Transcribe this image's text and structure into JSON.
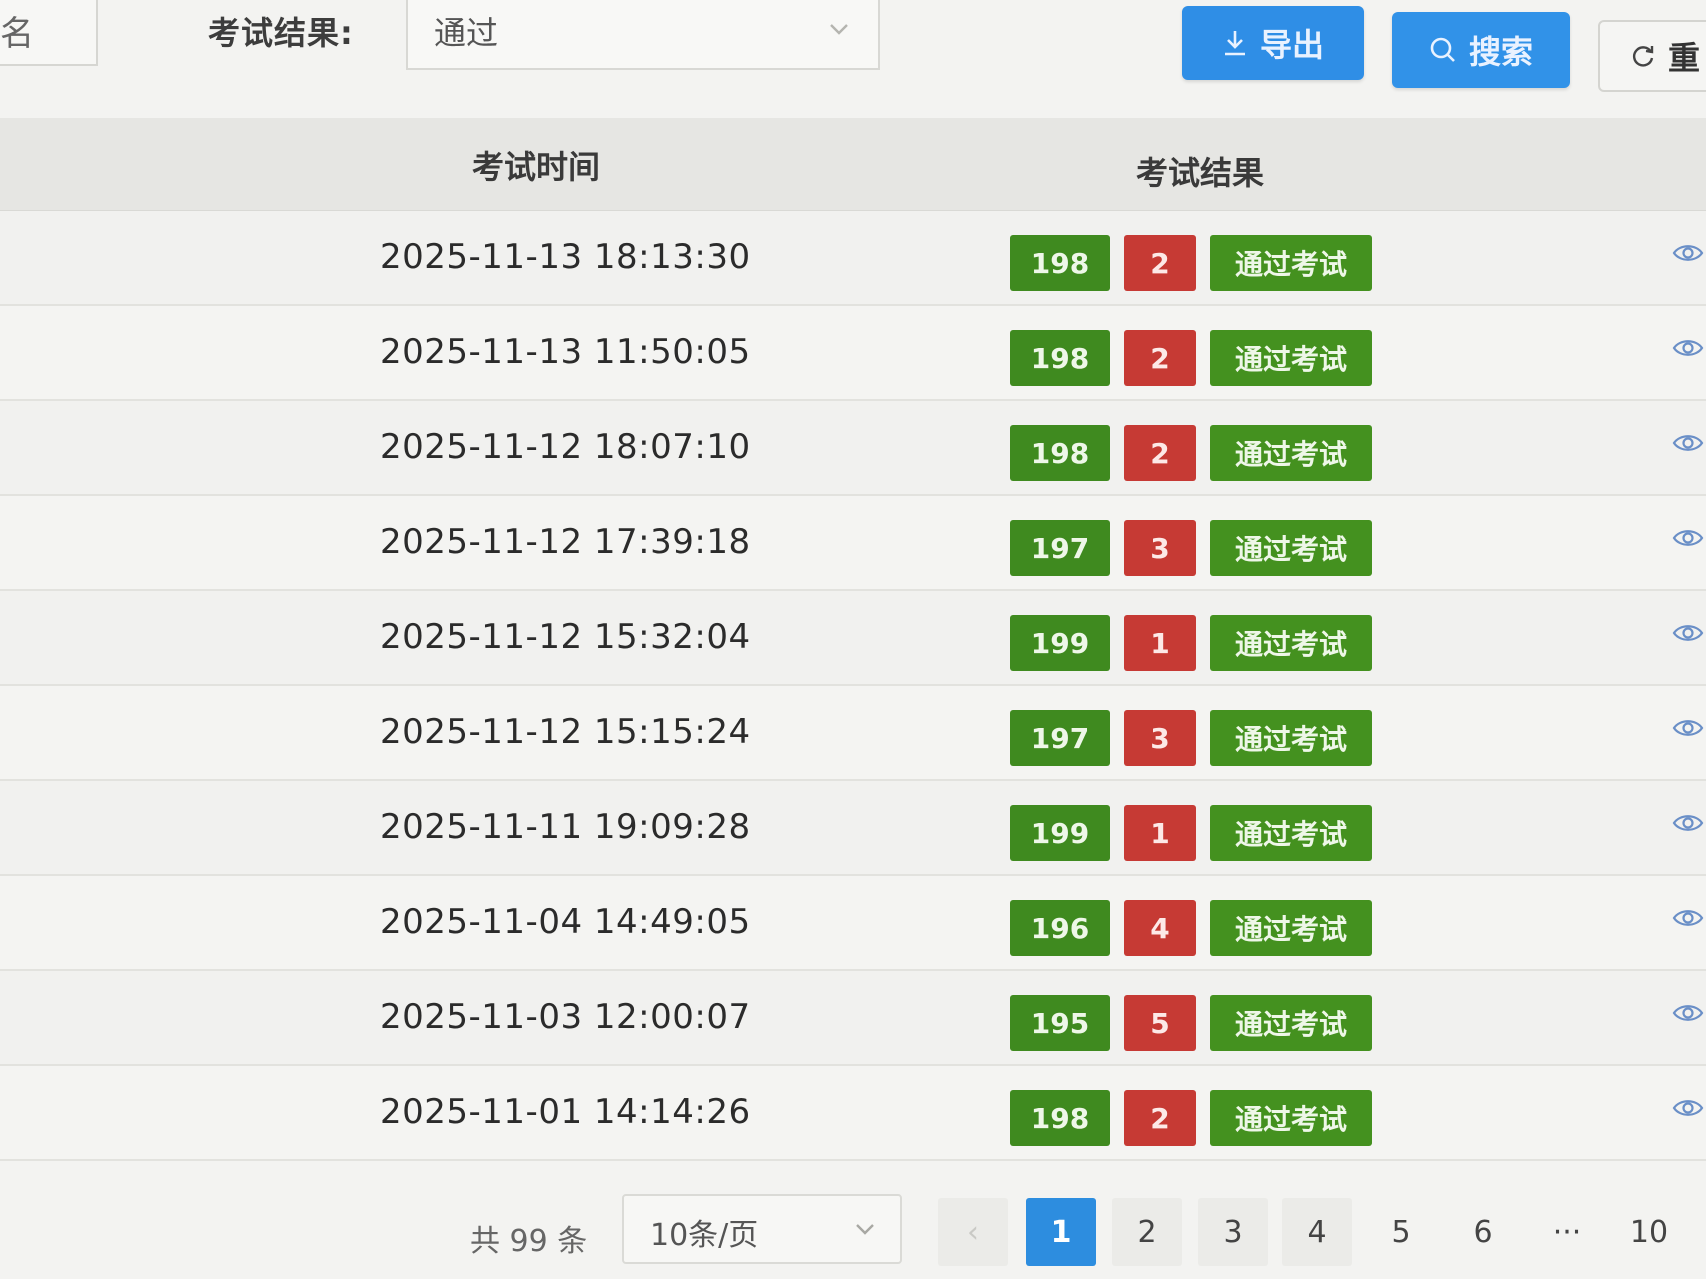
{
  "filter": {
    "name_label_partial": "名",
    "result_label": "考试结果:",
    "result_value": "通过"
  },
  "toolbar": {
    "export_label": "导出",
    "search_label": "搜索",
    "reset_label": "重"
  },
  "table": {
    "headers": {
      "time": "考试时间",
      "result": "考试结果"
    },
    "rows": [
      {
        "time": "2025-11-13 18:13:30",
        "score": "198",
        "wrong": "2",
        "status": "通过考试"
      },
      {
        "time": "2025-11-13 11:50:05",
        "score": "198",
        "wrong": "2",
        "status": "通过考试"
      },
      {
        "time": "2025-11-12 18:07:10",
        "score": "198",
        "wrong": "2",
        "status": "通过考试"
      },
      {
        "time": "2025-11-12 17:39:18",
        "score": "197",
        "wrong": "3",
        "status": "通过考试"
      },
      {
        "time": "2025-11-12 15:32:04",
        "score": "199",
        "wrong": "1",
        "status": "通过考试"
      },
      {
        "time": "2025-11-12 15:15:24",
        "score": "197",
        "wrong": "3",
        "status": "通过考试"
      },
      {
        "time": "2025-11-11 19:09:28",
        "score": "199",
        "wrong": "1",
        "status": "通过考试"
      },
      {
        "time": "2025-11-04 14:49:05",
        "score": "196",
        "wrong": "4",
        "status": "通过考试"
      },
      {
        "time": "2025-11-03 12:00:07",
        "score": "195",
        "wrong": "5",
        "status": "通过考试"
      },
      {
        "time": "2025-11-01 14:14:26",
        "score": "198",
        "wrong": "2",
        "status": "通过考试"
      }
    ]
  },
  "pagination": {
    "total": "共 99 条",
    "page_size": "10条/页",
    "prev": "‹",
    "pages": [
      "1",
      "2",
      "3",
      "4",
      "5",
      "6",
      "···",
      "10"
    ],
    "current": "1"
  },
  "colors": {
    "primary": "#2f8ee6",
    "score_tag": "#3f8a1f",
    "wrong_tag": "#c63a34",
    "pass_tag": "#44911f"
  },
  "icons": {
    "export": "download-icon",
    "search": "search-icon",
    "reset": "refresh-icon",
    "row_action": "eye-icon",
    "select": "chevron-down-icon"
  }
}
